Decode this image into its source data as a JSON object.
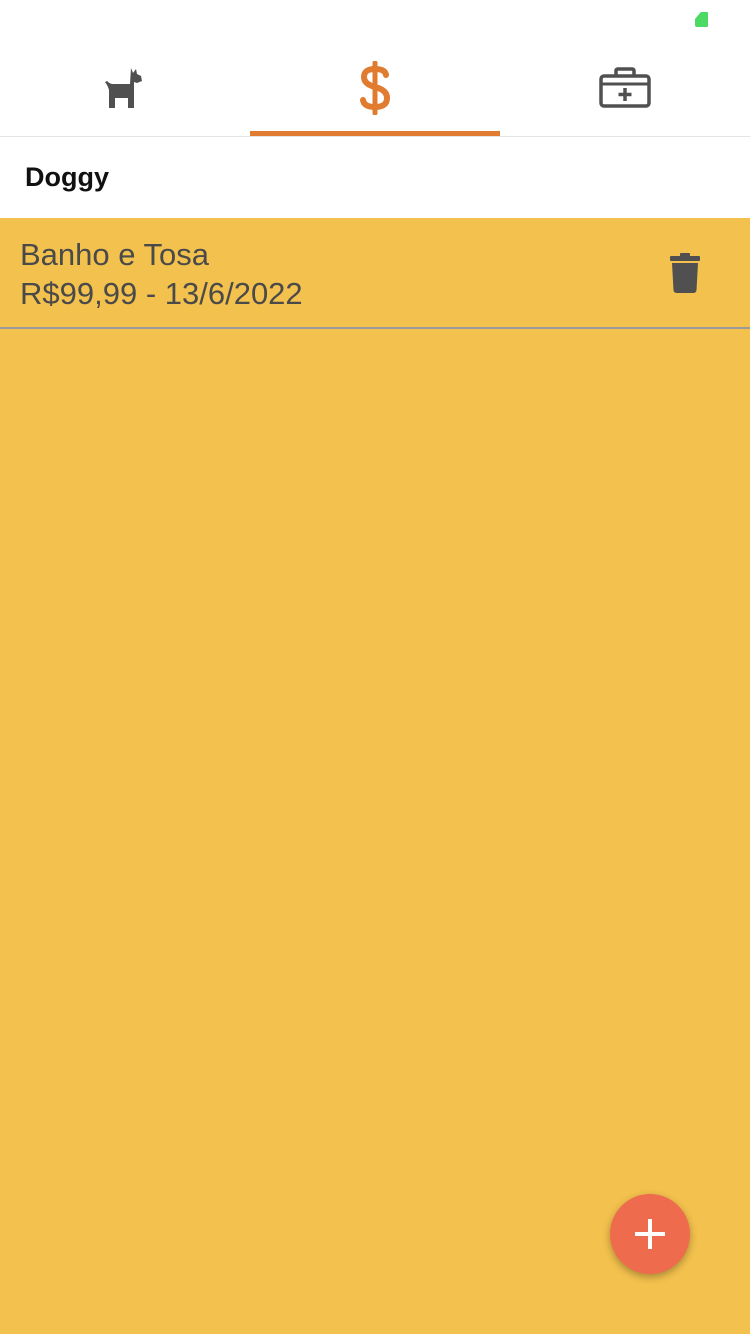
{
  "colors": {
    "accent": "#e07b2f",
    "background": "#f3c14d",
    "fab": "#ee6b4d",
    "icon_gray": "#505050",
    "battery": "#4cd964"
  },
  "tabs": [
    {
      "icon": "dog-icon",
      "active": false
    },
    {
      "icon": "dollar-icon",
      "active": true
    },
    {
      "icon": "medical-kit-icon",
      "active": false
    }
  ],
  "pet": {
    "name": "Doggy"
  },
  "expenses": [
    {
      "title": "Banho e Tosa",
      "subtitle": "R$99,99 - 13/6/2022",
      "action_icon": "trash-icon"
    }
  ],
  "fab": {
    "icon": "plus-icon"
  }
}
